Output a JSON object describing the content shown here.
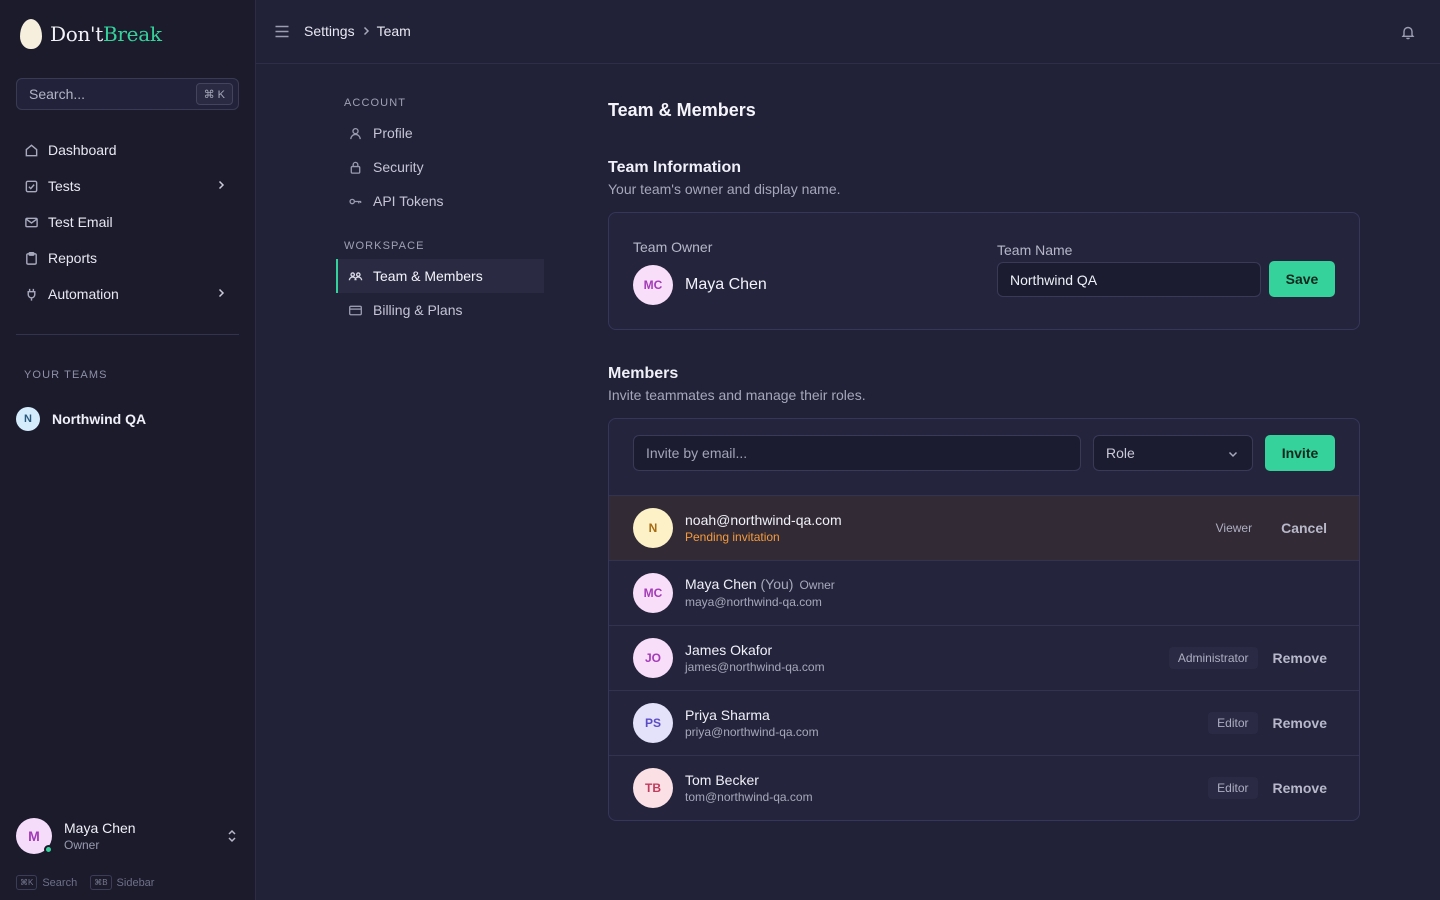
{
  "app": {
    "logo": {
      "part1": "Don't",
      "part2": "Break"
    },
    "search": {
      "placeholder": "Search...",
      "shortcut": "⌘ K"
    },
    "nav": [
      {
        "label": "Dashboard",
        "icon": "home-icon",
        "chevron": false
      },
      {
        "label": "Tests",
        "icon": "check-square-icon",
        "chevron": true
      },
      {
        "label": "Test Email",
        "icon": "mail-icon",
        "chevron": false
      },
      {
        "label": "Reports",
        "icon": "clipboard-icon",
        "chevron": false
      },
      {
        "label": "Automation",
        "icon": "plug-icon",
        "chevron": true
      }
    ],
    "teams_label": "YOUR TEAMS",
    "team": {
      "initial": "N",
      "name": "Northwind QA"
    },
    "user": {
      "initial": "M",
      "name": "Maya Chen",
      "role": "Owner"
    },
    "shortcuts": [
      {
        "key": "⌘K",
        "label": "Search"
      },
      {
        "key": "⌘B",
        "label": "Sidebar"
      }
    ]
  },
  "header": {
    "breadcrumb": [
      "Settings",
      "Team"
    ]
  },
  "settings_nav": {
    "account_label": "ACCOUNT",
    "account_items": [
      "Profile",
      "Security",
      "API Tokens"
    ],
    "workspace_label": "WORKSPACE",
    "workspace_items": [
      "Team & Members",
      "Billing & Plans"
    ]
  },
  "main": {
    "title": "Team & Members",
    "team_info": {
      "title": "Team Information",
      "description": "Your team's owner and display name.",
      "owner_label": "Team Owner",
      "owner_initials": "MC",
      "owner_name": "Maya Chen",
      "team_name_label": "Team Name",
      "team_name_value": "Northwind QA",
      "save_label": "Save"
    },
    "members": {
      "title": "Members",
      "description": "Invite teammates and manage their roles.",
      "invite_placeholder": "Invite by email...",
      "role_placeholder": "Role",
      "invite_label": "Invite",
      "pending": {
        "initials": "N",
        "email": "noah@northwind-qa.com",
        "status": "Pending invitation",
        "role": "Viewer",
        "action": "Cancel"
      },
      "rows": [
        {
          "initials": "MC",
          "name": "Maya Chen",
          "you": "(You)",
          "tag": "Owner",
          "email": "maya@northwind-qa.com",
          "role": "",
          "action": ""
        },
        {
          "initials": "JO",
          "name": "James Okafor",
          "you": "",
          "tag": "",
          "email": "james@northwind-qa.com",
          "role": "Administrator",
          "action": "Remove"
        },
        {
          "initials": "PS",
          "name": "Priya Sharma",
          "you": "",
          "tag": "",
          "email": "priya@northwind-qa.com",
          "role": "Editor",
          "action": "Remove"
        },
        {
          "initials": "TB",
          "name": "Tom Becker",
          "you": "",
          "tag": "",
          "email": "tom@northwind-qa.com",
          "role": "Editor",
          "action": "Remove"
        }
      ]
    }
  },
  "colors": {
    "accent": "#35d39b",
    "background": "#212138",
    "sidebar": "#1b1b2c",
    "pending_text": "#f59a3e"
  }
}
